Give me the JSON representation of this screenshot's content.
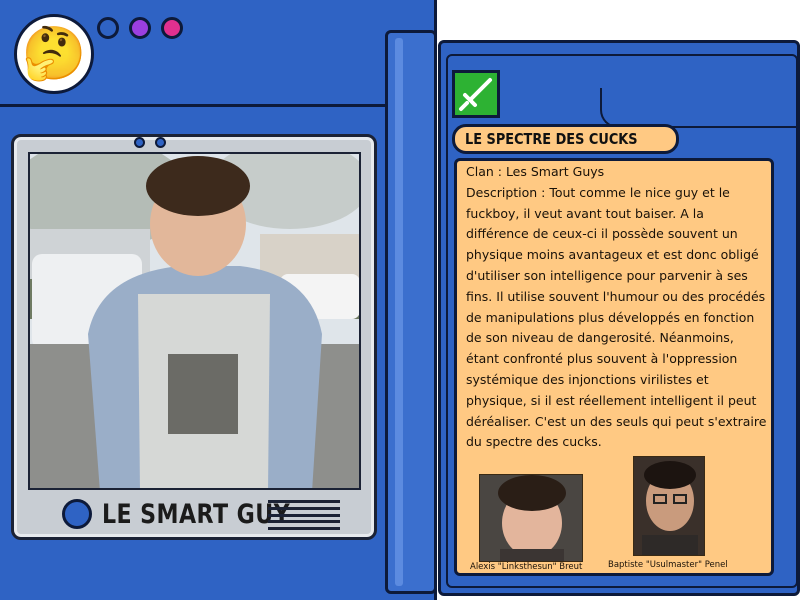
{
  "header": {
    "avatar_emoji": "🤔",
    "indicator_lights": [
      "#2f63c4",
      "#9b3fe0",
      "#e0308f"
    ]
  },
  "profile": {
    "name": "LE SMART GUY",
    "photo_icon": "person-photo"
  },
  "card": {
    "type_icon": "sword-icon",
    "type_color": "#2db233",
    "title": "LE SPECTRE DES CUCKS",
    "clan_line": "Clan : Les Smart Guys",
    "description": "Description : Tout comme le nice guy et le fuckboy, il veut avant tout baiser. A la différence de ceux-ci il possède souvent un physique moins avantageux et est donc obligé d'utiliser son intelligence pour parvenir à ses fins. Il utilise souvent l'humour ou des procédés de manipulations plus développés en fonction de son niveau de dangerosité. Néanmoins, étant confronté plus souvent à l'oppression systémique des injonctions virilistes et physique, si il est réellement intelligent il peut déréaliser. C'est un des seuls qui peut s'extraire du spectre des cucks."
  },
  "examples": [
    {
      "caption": "Alexis \"Linksthesun\" Breut"
    },
    {
      "caption": "Baptiste \"Usulmaster\" Penel"
    }
  ],
  "colors": {
    "case_blue": "#2f63c4",
    "outline": "#0d1a3a",
    "card_cream": "#ffc983",
    "screen_gray": "#c8cdd3"
  }
}
